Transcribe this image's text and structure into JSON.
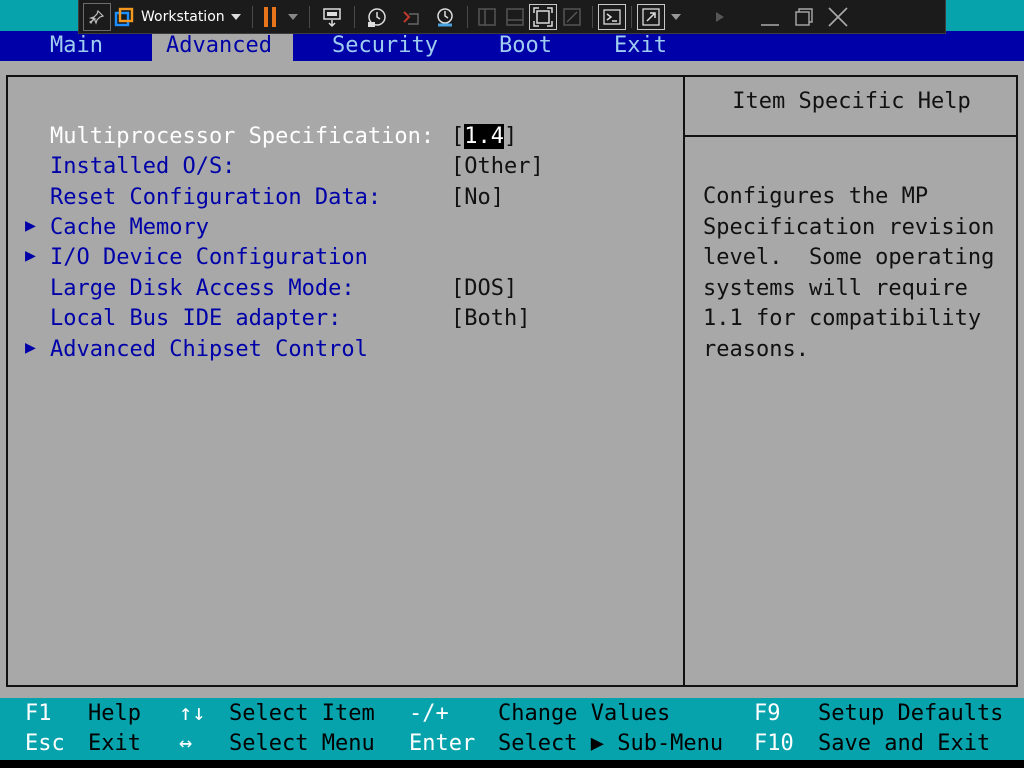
{
  "toolbar": {
    "vm_name": "Workstation",
    "icons": [
      "pin-icon",
      "vmware-logo-icon",
      "dropdown-icon",
      "pause-icon",
      "dropdown-icon",
      "send-ctrl-alt-del-icon",
      "snapshot-icon",
      "revert-snapshot-icon",
      "snapshot-manager-icon",
      "library-icon",
      "show-console-icon",
      "full-screen-icon",
      "unity-icon",
      "terminal-icon",
      "stretch-icon",
      "dropdown-icon",
      "forward-icon",
      "minimize-icon",
      "restore-icon",
      "close-icon"
    ]
  },
  "menu": {
    "items": [
      "Main",
      "Advanced",
      "Security",
      "Boot",
      "Exit"
    ],
    "active": "Advanced"
  },
  "settings": [
    {
      "label": "Multiprocessor Specification:",
      "value_prefix": "[",
      "value": "1.4",
      "value_suffix": "]",
      "submenu": false,
      "selected": true
    },
    {
      "label": "Installed O/S:",
      "value": "[Other]",
      "submenu": false,
      "selected": false
    },
    {
      "label": "Reset Configuration Data:",
      "value": "[No]",
      "submenu": false,
      "selected": false
    },
    {
      "label": "Cache Memory",
      "value": "",
      "submenu": true,
      "selected": false
    },
    {
      "label": "I/O Device Configuration",
      "value": "",
      "submenu": true,
      "selected": false
    },
    {
      "label": "Large Disk Access Mode:",
      "value": "[DOS]",
      "submenu": false,
      "selected": false
    },
    {
      "label": "Local Bus IDE adapter:",
      "value": "[Both]",
      "submenu": false,
      "selected": false
    },
    {
      "label": "Advanced Chipset Control",
      "value": "",
      "submenu": true,
      "selected": false
    }
  ],
  "submenu_marker": "▶",
  "help": {
    "title": "Item Specific Help",
    "text": "Configures the MP\nSpecification revision\nlevel.  Some operating\nsystems will require\n1.1 for compatibility\nreasons."
  },
  "keys": {
    "row1": [
      {
        "key": "F1",
        "desc": "Help"
      },
      {
        "key": "↑↓",
        "desc": "Select Item"
      },
      {
        "key": "-/+",
        "desc": "Change Values"
      },
      {
        "key": "F9",
        "desc": "Setup Defaults"
      }
    ],
    "row2": [
      {
        "key": "Esc",
        "desc": "Exit"
      },
      {
        "key": "↔",
        "desc": "Select Menu"
      },
      {
        "key": "Enter",
        "desc": "Select ▶ Sub-Menu"
      },
      {
        "key": "F10",
        "desc": "Save and Exit"
      }
    ]
  },
  "colors": {
    "bios_blue": "#0000a8",
    "panel_gray": "#a8a8a8",
    "footer_cyan": "#07a3ad",
    "inactive_menu_text": "#9ecdf0",
    "pause_orange": "#e8751a"
  }
}
